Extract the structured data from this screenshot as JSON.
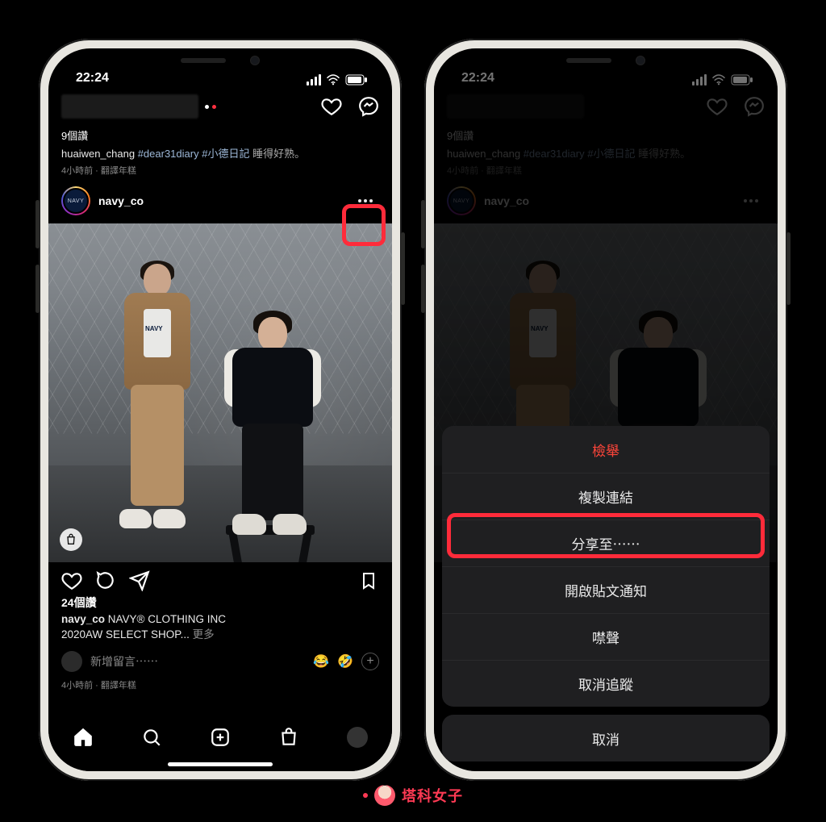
{
  "status": {
    "time": "22:24"
  },
  "header": {
    "heart_icon": "heart-icon",
    "messenger_icon": "messenger-icon"
  },
  "prev_post": {
    "likes": "9個讚",
    "username": "huaiwen_chang",
    "hashtag1": "#dear31diary",
    "hashtag2": "#小德日記",
    "tail_text": " 睡得好熟。",
    "time": "4小時前",
    "separator": " · ",
    "translate": "翻譯年糕"
  },
  "post": {
    "avatar_text": "NAVY",
    "username": "navy_co",
    "likes": "24個讚",
    "caption_user": "navy_co",
    "caption_line1": " NAVY® CLOTHING INC",
    "caption_line2": "2020AW SELECT SHOP... ",
    "more": "更多",
    "comment_placeholder": "新增留言⋯⋯",
    "emoji1": "😂",
    "emoji2": "🤣",
    "time": "4小時前",
    "separator": " · ",
    "translate": "翻譯年糕"
  },
  "action_sheet": {
    "report": "檢舉",
    "copy_link": "複製連結",
    "share_to": "分享至⋯⋯",
    "post_notifications": "開啟貼文通知",
    "mute": "噤聲",
    "unfollow": "取消追蹤",
    "cancel": "取消"
  },
  "watermark": {
    "text": "塔科女子"
  }
}
